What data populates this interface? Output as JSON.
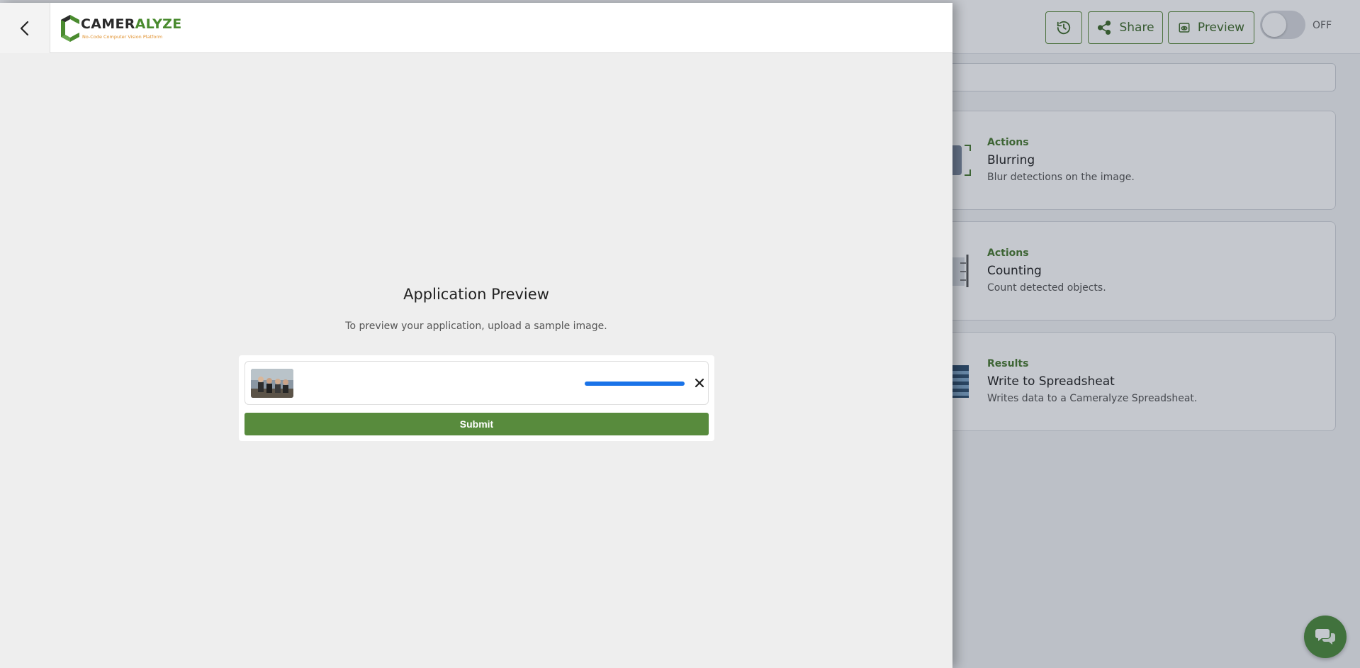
{
  "toolbar": {
    "share_label": "Share",
    "preview_label": "Preview",
    "toggle_state": "OFF"
  },
  "cards": [
    {
      "category": "Actions",
      "title": "Blurring",
      "description": "Blur detections on the image."
    },
    {
      "category": "Actions",
      "title": "Counting",
      "description": "Count detected objects."
    },
    {
      "category": "Results",
      "title": "Write to Spreadsheat",
      "description": "Writes data to a Cameralyze Spreadsheat."
    }
  ],
  "drawer": {
    "logo": {
      "main": "CAMER",
      "accent": "ALYZE",
      "tagline": "No-Code Computer Vision Platform"
    },
    "title": "Application Preview",
    "subtitle": "To preview your application, upload a sample image.",
    "upload_progress": 1.0,
    "submit_label": "Submit"
  },
  "colors": {
    "brand_green": "#588b3d",
    "progress_blue": "#1a73e8",
    "logo_orange": "#e0902d"
  },
  "icons": [
    "history-icon",
    "share-icon",
    "eye-icon",
    "chat-icon",
    "back-chevron-icon",
    "close-icon"
  ]
}
